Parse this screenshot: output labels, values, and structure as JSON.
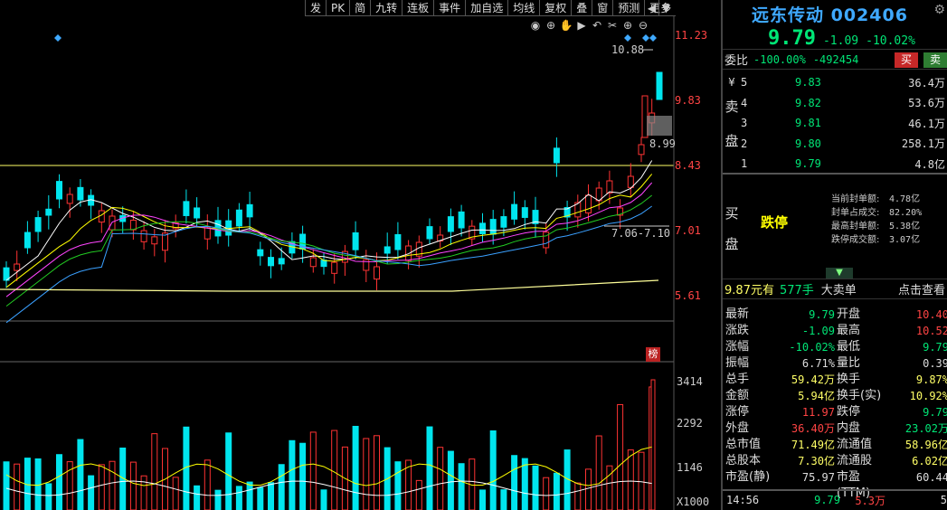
{
  "toolbar": {
    "items": [
      "发",
      "PK",
      "简",
      "九转",
      "连板",
      "事件",
      "加自选",
      "均线",
      "复权",
      "叠",
      "窗",
      "预测",
      "更多"
    ]
  },
  "chart": {
    "price_axis": [
      "11.23",
      "9.83",
      "8.43",
      "7.01",
      "5.61"
    ],
    "high_annotation": "10.88",
    "gap_annotation": "8.99",
    "range_annotation": "7.06-7.10",
    "volume_axis": [
      "3414",
      "2292",
      "1146"
    ],
    "volume_unit": "X1000",
    "badge": "榜",
    "colors": {
      "up": "#ff3333",
      "down": "#00e5ee",
      "ma5": "#ffffff",
      "ma10": "#ffff00",
      "ma20": "#ff44ff",
      "ma30": "#22cc22",
      "ma60": "#3aa0ff",
      "ma120": "#ffff99"
    }
  },
  "quote": {
    "name": "远东传动 002406",
    "price": "9.79",
    "change": "-1.09",
    "pct": "-10.02%",
    "weibi_label": "委比",
    "weibi_pct": "-100.00%",
    "weibi_diff": "-492454",
    "buy_label": "买",
    "sell_label": "卖",
    "sell_side_label": "卖盘",
    "buy_side_label": "买盘",
    "currency": "¥",
    "sell_book": [
      {
        "level": "5",
        "price": "9.83",
        "qty": "36.4万"
      },
      {
        "level": "4",
        "price": "9.82",
        "qty": "53.6万"
      },
      {
        "level": "3",
        "price": "9.81",
        "qty": "46.1万"
      },
      {
        "level": "2",
        "price": "9.80",
        "qty": "258.1万"
      },
      {
        "level": "1",
        "price": "9.79",
        "qty": "4.8亿"
      }
    ],
    "limit_text": "跌停",
    "seal_stats": [
      {
        "k": "当前封单额:",
        "v": "4.78亿"
      },
      {
        "k": "封单占成交:",
        "v": "82.20%"
      },
      {
        "k": "最高封单额:",
        "v": "5.38亿"
      },
      {
        "k": "跌停成交额:",
        "v": "3.07亿"
      }
    ],
    "bigorder": {
      "a": "9.87元有",
      "b": "577手",
      "c": "大卖单",
      "d": "点击查看"
    },
    "stats": [
      {
        "k": "最新",
        "v": "9.79",
        "vc": "green",
        "k2": "开盘",
        "v2": "10.40",
        "v2c": "red"
      },
      {
        "k": "涨跌",
        "v": "-1.09",
        "vc": "green",
        "k2": "最高",
        "v2": "10.52",
        "v2c": "red"
      },
      {
        "k": "涨幅",
        "v": "-10.02%",
        "vc": "green",
        "k2": "最低",
        "v2": "9.79",
        "v2c": "green"
      },
      {
        "k": "振幅",
        "v": "6.71%",
        "vc": "white",
        "k2": "量比",
        "v2": "0.39",
        "v2c": "white"
      },
      {
        "k": "总手",
        "v": "59.42万",
        "vc": "yellow",
        "k2": "换手",
        "v2": "9.87%",
        "v2c": "yellow"
      },
      {
        "k": "金额",
        "v": "5.94亿",
        "vc": "yellow",
        "k2": "换手(实)",
        "v2": "10.92%",
        "v2c": "yellow"
      },
      {
        "k": "涨停",
        "v": "11.97",
        "vc": "red",
        "k2": "跌停",
        "v2": "9.79",
        "v2c": "green"
      },
      {
        "k": "外盘",
        "v": "36.40万",
        "vc": "red",
        "k2": "内盘",
        "v2": "23.02万",
        "v2c": "green"
      },
      {
        "k": "总市值",
        "v": "71.49亿",
        "vc": "yellow",
        "k2": "流通值",
        "v2": "58.96亿",
        "v2c": "yellow"
      },
      {
        "k": "总股本",
        "v": "7.30亿",
        "vc": "yellow",
        "k2": "流通股",
        "v2": "6.02亿",
        "v2c": "yellow"
      },
      {
        "k": "市盈(静)",
        "v": "75.97",
        "vc": "white",
        "k2": "市盈(TTM)",
        "v2": "60.44",
        "v2c": "white"
      }
    ],
    "tick": {
      "time": "14:56",
      "price": "9.79",
      "vol": "5.3万",
      "num": "5"
    }
  }
}
